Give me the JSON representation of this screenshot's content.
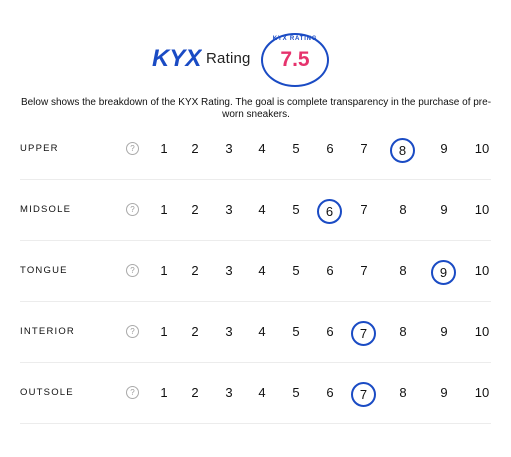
{
  "header": {
    "logo": "KYX",
    "rating_word": "Rating",
    "badge_label": "KYX RATING",
    "score": "7.5",
    "colors": {
      "accent": "#1a4bc4",
      "score": "#e6336d"
    }
  },
  "intro": "Below shows the breakdown of the KYX Rating. The goal is complete transparency in the purchase of pre-worn sneakers.",
  "scale": [
    "1",
    "2",
    "3",
    "4",
    "5",
    "6",
    "7",
    "8",
    "9",
    "10"
  ],
  "rows": [
    {
      "label": "UPPER",
      "selected": 8
    },
    {
      "label": "MIDSOLE",
      "selected": 6
    },
    {
      "label": "TONGUE",
      "selected": 9
    },
    {
      "label": "INTERIOR",
      "selected": 7
    },
    {
      "label": "OUTSOLE",
      "selected": 7
    }
  ],
  "help_icon": "question-circle-icon"
}
